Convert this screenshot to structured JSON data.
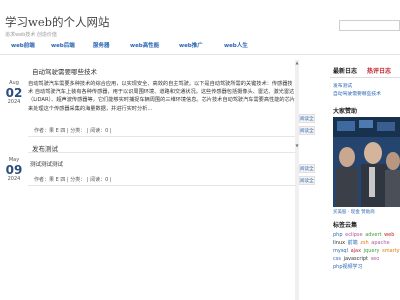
{
  "site": {
    "title": "学习web的个人网站",
    "tagline": "追求web技术 创造价值"
  },
  "nav": {
    "items": [
      {
        "label": "web前端"
      },
      {
        "label": "web后端"
      },
      {
        "label": "服务器"
      },
      {
        "label": "web高性能"
      },
      {
        "label": "web推广"
      },
      {
        "label": "web人生"
      }
    ]
  },
  "articles": [
    {
      "title": "自动驾驶需要哪些技术",
      "date": {
        "month": "Aug",
        "day": "02",
        "year": "2024"
      },
      "body": "自动驾驶汽车需要多种技术的综合应用，以实现安全、高效的自主驾驶。以下是自动驾驶所需的关键技术：传感器技术 自动驾驶汽车上装有各种传感器，用于以识周围环境、道路和交通状况。这些传感器包括摄像头、雷达、激光雷达（LiDAR）、超声波传感器等，它们能够实时捕捉车辆周围的三维环境信息。芯片技术自动驾驶汽车需要高性能的芯片来处理这个传感器采集的海量数据，并进行实时分析...",
      "meta": "作者：果 E 四 | 分类： | 阅读：0 |",
      "more_label": "阅读全文"
    },
    {
      "section_title": "发布测试",
      "title": "测试测试测试",
      "date": {
        "month": "May",
        "day": "09",
        "year": "2024"
      },
      "meta": "作者：果 E 四 | 分类： | 阅读：0 |",
      "more_label": "阅读全文"
    }
  ],
  "sidebar": {
    "tabs": [
      {
        "label": "最新日志"
      },
      {
        "label": "热评日志"
      }
    ],
    "latest_links": [
      "发布测试",
      "自动驾驶需要哪些技术"
    ],
    "donate": {
      "title": "大家赞助",
      "caption": "买美股 · 现金 赞助商"
    },
    "tags_title": "标签云集",
    "tags": [
      {
        "label": "php",
        "color": "#2a67b2"
      },
      {
        "label": "eclipse",
        "color": "#b0599a"
      },
      {
        "label": "advert",
        "color": "#3aa03a"
      },
      {
        "label": "web",
        "color": "#c0272d"
      },
      {
        "label": "linux",
        "color": "#333333"
      },
      {
        "label": "前端",
        "color": "#2a67b2"
      },
      {
        "label": "zsh",
        "color": "#e07a10"
      },
      {
        "label": "apache",
        "color": "#b0599a"
      },
      {
        "label": "mysql",
        "color": "#2a67b2"
      },
      {
        "label": "ajax",
        "color": "#c0272d"
      },
      {
        "label": "jquery",
        "color": "#3aa03a"
      },
      {
        "label": "smarty",
        "color": "#e07a10"
      },
      {
        "label": "css",
        "color": "#2a67b2"
      },
      {
        "label": "javascript",
        "color": "#333333"
      },
      {
        "label": "seo",
        "color": "#b0599a"
      },
      {
        "label": "php视频学习",
        "color": "#2a67b2"
      }
    ]
  }
}
